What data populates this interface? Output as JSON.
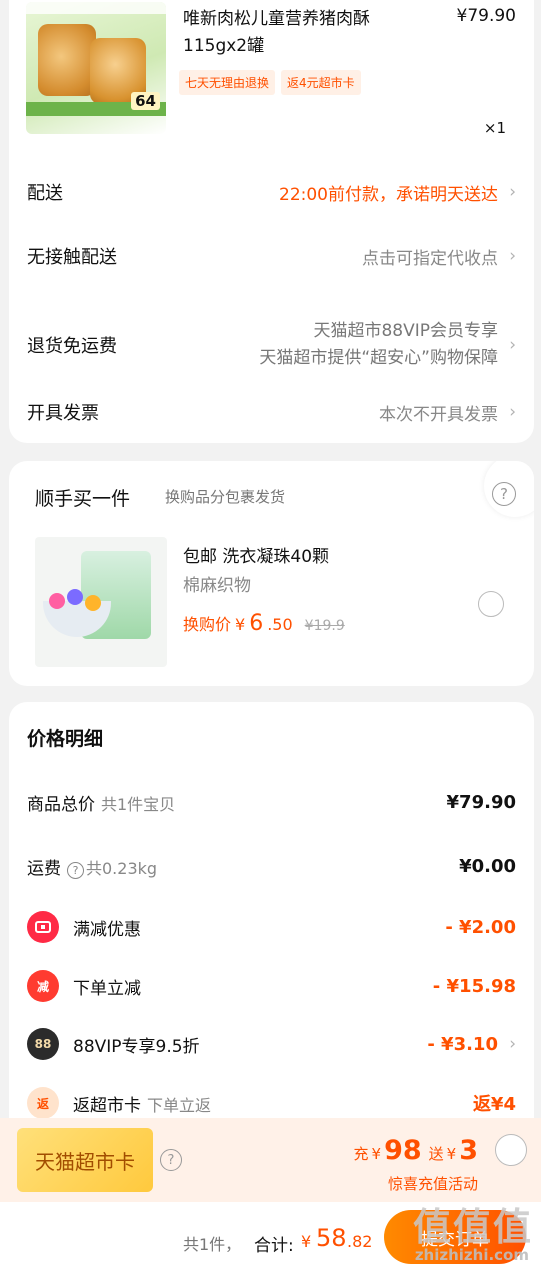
{
  "order": {
    "product": {
      "title": "唯新肉松儿童营养猪肉酥115gx2罐",
      "price": "¥79.90",
      "tags": [
        "七天无理由退换",
        "返4元超市卡"
      ],
      "quantity": "×1",
      "thumb_price": "64"
    },
    "rows": [
      {
        "label": "配送",
        "value": "22:00前付款，承诺明天送达"
      },
      {
        "label": "无接触配送",
        "value": "点击可指定代收点"
      },
      {
        "label": "退货免运费",
        "value_line1": "天猫超市88VIP会员专享",
        "value_line2": "天猫超市提供“超安心”购物保障"
      },
      {
        "label": "开具发票",
        "value": "本次不开具发票"
      }
    ]
  },
  "addon": {
    "title": "顺手买一件",
    "subtitle": "换购品分包裹发货",
    "item_name": "包邮 洗衣凝珠40颗",
    "item_spec": "棉麻织物",
    "swap_label": "换购价",
    "swap_yen": "¥",
    "swap_int": "6",
    "swap_dec": ".50",
    "orig_price": "¥19.9"
  },
  "price_detail": {
    "title": "价格明细",
    "goods_label": "商品总价",
    "goods_sub": "共1件宝贝",
    "goods_value": "¥79.90",
    "shipping_label": "运费",
    "shipping_sub": "共0.23kg",
    "shipping_value": "¥0.00",
    "discounts": [
      {
        "icon_text": "",
        "label": "满减优惠",
        "value": "- ¥2.00"
      },
      {
        "icon_text": "减",
        "label": "下单立减",
        "value": "- ¥15.98"
      },
      {
        "icon_text": "88",
        "label": "88VIP专享9.5折",
        "value": "- ¥3.10"
      },
      {
        "icon_text": "返",
        "label": "返超市卡",
        "sub": "下单立返",
        "value": "返¥4"
      }
    ]
  },
  "promo": {
    "card_label": "天猫超市卡",
    "charge_word": "充",
    "charge_yen": "¥",
    "charge_amount": "98",
    "bonus_word": "送",
    "bonus_yen": "¥",
    "bonus_amount": "3",
    "link": "惊喜充值活动"
  },
  "bottom_bar": {
    "count": "共1件，",
    "total_label": "合计:",
    "total_yen": "¥",
    "total_int": "58",
    "total_dec": ".82",
    "submit": "提交订单"
  },
  "watermark": {
    "main": "值值值",
    "sub": "zhizhizhi.com"
  },
  "colors": {
    "accent": "#ff5000",
    "background": "#f2f2f2"
  }
}
